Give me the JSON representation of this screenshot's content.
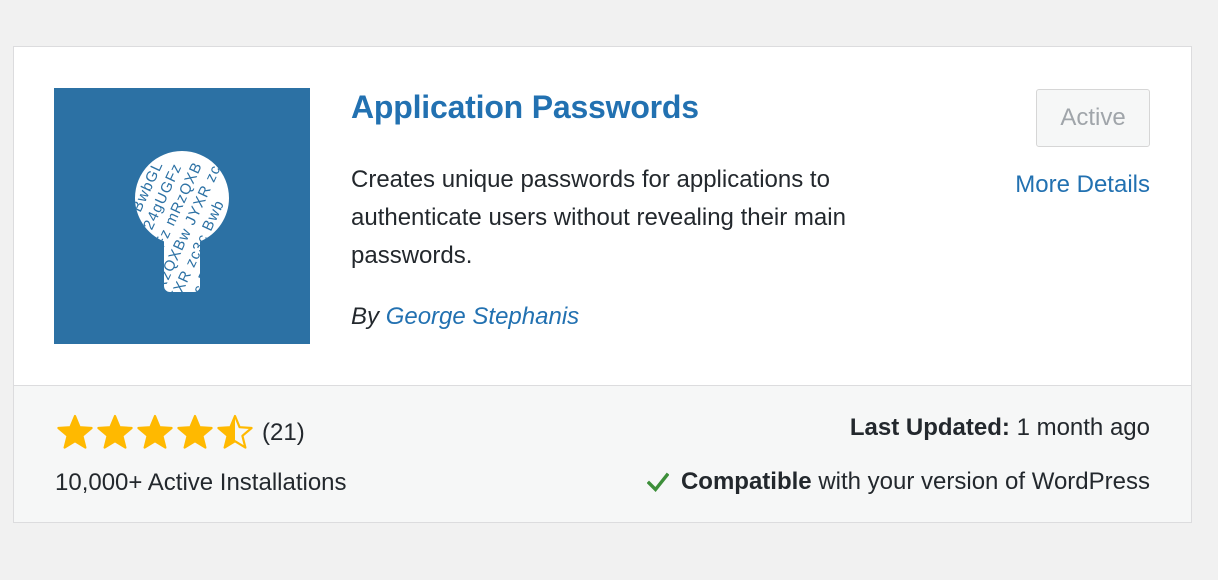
{
  "plugin": {
    "name": "Application Passwords",
    "description": "Creates unique passwords for applications to authenticate users without revealing their main passwords.",
    "author_prefix": "By",
    "author": "George Stephanis",
    "icon": "keyhole-icon",
    "icon_text": "zc3c BwbGLj 24gUGFz mRzQXBw JYXR zc3c"
  },
  "actions": {
    "active_label": "Active",
    "more_details_label": "More Details"
  },
  "footer": {
    "rating_value": 4.5,
    "rating_max": 5,
    "rating_count": "(21)",
    "installs": "10,000+ Active Installations",
    "last_updated_label": "Last Updated:",
    "last_updated_value": "1 month ago",
    "compat_strong": "Compatible",
    "compat_rest": "with your version of WordPress"
  },
  "colors": {
    "link": "#2271b1",
    "icon_bg": "#2c71a4",
    "star": "#ffb900",
    "check": "#3d8f3a"
  }
}
